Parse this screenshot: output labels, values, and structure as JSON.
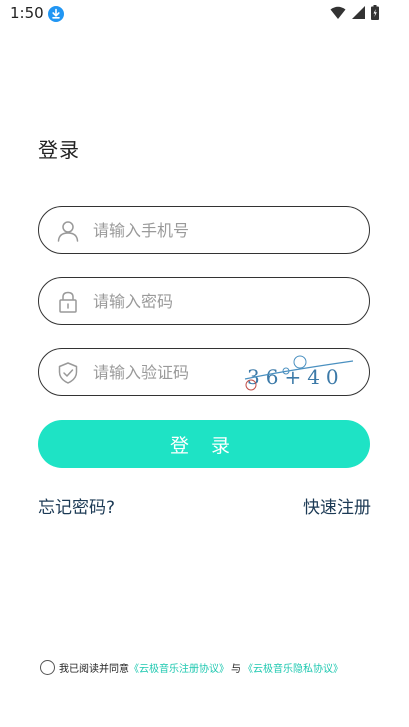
{
  "status_bar": {
    "time": "1:50"
  },
  "login": {
    "title": "登录",
    "phone_placeholder": "请输入手机号",
    "password_placeholder": "请输入密码",
    "code_placeholder": "请输入验证码",
    "captcha_text": "36+40",
    "button_label": "登 录",
    "forgot_password": "忘记密码?",
    "register": "快速注册"
  },
  "agreement": {
    "prefix": "我已阅读并同意",
    "user_agreement": "《云极音乐注册协议》",
    "connector": "与",
    "privacy_policy": "《云极音乐隐私协议》"
  },
  "colors": {
    "accent": "#1ee3c5",
    "link": "#1ec8b0",
    "text_link_dark": "#1c3a55"
  }
}
